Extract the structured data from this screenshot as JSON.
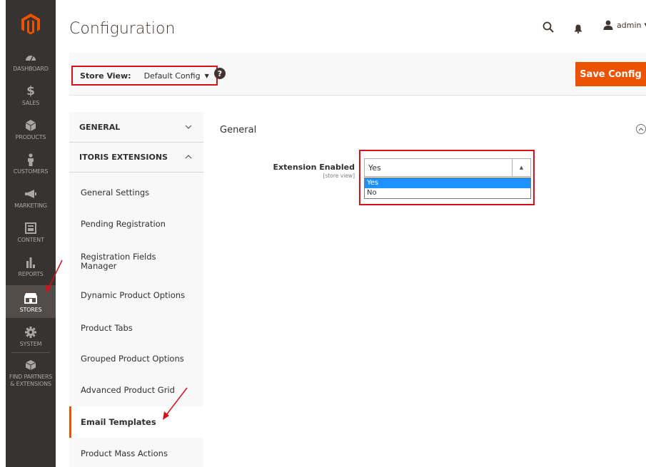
{
  "header": {
    "title": "Configuration",
    "user_name": "admin"
  },
  "sidebar": {
    "items": [
      {
        "label": "DASHBOARD",
        "icon": "dashboard-icon"
      },
      {
        "label": "SALES",
        "icon": "dollar-icon"
      },
      {
        "label": "PRODUCTS",
        "icon": "cube-icon"
      },
      {
        "label": "CUSTOMERS",
        "icon": "person-icon"
      },
      {
        "label": "MARKETING",
        "icon": "megaphone-icon"
      },
      {
        "label": "CONTENT",
        "icon": "layout-icon"
      },
      {
        "label": "REPORTS",
        "icon": "bar-chart-icon"
      },
      {
        "label": "STORES",
        "icon": "store-icon"
      },
      {
        "label": "SYSTEM",
        "icon": "gear-icon"
      },
      {
        "label": "FIND PARTNERS & EXTENSIONS",
        "icon": "box-icon"
      }
    ]
  },
  "toolbar": {
    "store_view_label": "Store View:",
    "store_view_value": "Default Config",
    "help_glyph": "?",
    "save_label": "Save Config"
  },
  "config_nav": {
    "sections": [
      {
        "label": "GENERAL"
      },
      {
        "label": "ITORIS EXTENSIONS"
      }
    ],
    "items": [
      {
        "label": "General Settings"
      },
      {
        "label": "Pending Registration"
      },
      {
        "label": "Registration Fields Manager"
      },
      {
        "label": "Dynamic Product Options"
      },
      {
        "label": "Product Tabs"
      },
      {
        "label": "Grouped Product Options"
      },
      {
        "label": "Advanced Product Grid"
      },
      {
        "label": "Email Templates"
      },
      {
        "label": "Product Mass Actions"
      }
    ]
  },
  "main": {
    "group_title": "General",
    "field": {
      "label": "Extension Enabled",
      "scope": "[store view]",
      "value": "Yes",
      "options": [
        "Yes",
        "No"
      ]
    }
  },
  "colors": {
    "accent": "#eb5202",
    "sidebar_bg": "#373330",
    "highlight": "#d1121b",
    "selected_option": "#1e90ff"
  }
}
